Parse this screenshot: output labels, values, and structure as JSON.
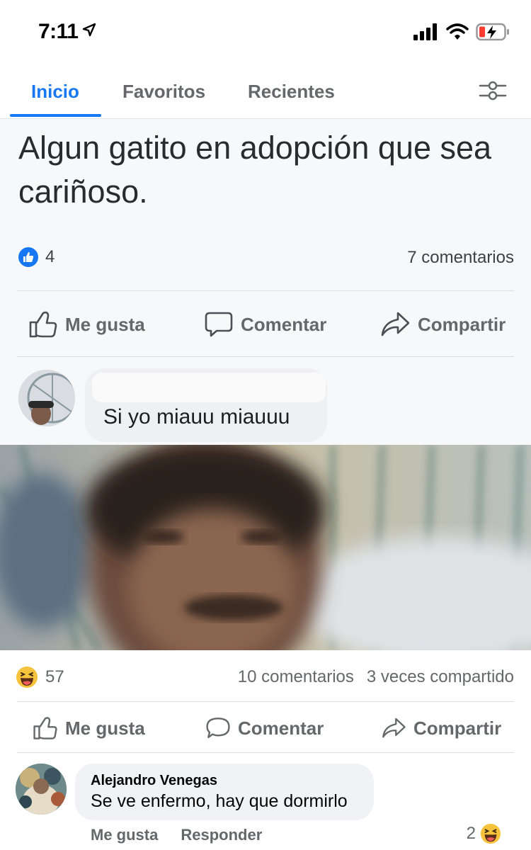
{
  "status_bar": {
    "time": "7:11",
    "icons": [
      "location-arrow-icon",
      "signal-icon",
      "wifi-icon",
      "battery-charging-icon"
    ]
  },
  "tabs": {
    "items": [
      {
        "label": "Inicio",
        "active": true
      },
      {
        "label": "Favoritos",
        "active": false
      },
      {
        "label": "Recientes",
        "active": false
      }
    ],
    "filter_icon": "sliders-icon"
  },
  "post1": {
    "text": "Algun gatito en adopción que sea cariñoso.",
    "like_count": "4",
    "comments": "7 comentarios",
    "actions": {
      "like": "Me gusta",
      "comment": "Comentar",
      "share": "Compartir"
    }
  },
  "comment1": {
    "text": "Si yo miauu miauuu"
  },
  "post2": {
    "reaction_count": "57",
    "comments": "10 comentarios",
    "shares": "3 veces compartido",
    "actions": {
      "like": "Me gusta",
      "comment": "Comentar",
      "share": "Compartir"
    }
  },
  "reply": {
    "author": "Alejandro Venegas",
    "text": "Se ve enfermo, hay que dormirlo",
    "like_label": "Me gusta",
    "reply_label": "Responder",
    "reaction_count": "2"
  },
  "colors": {
    "accent": "#1877f2",
    "secondary_text": "#65676b",
    "divider": "#dadde1"
  }
}
